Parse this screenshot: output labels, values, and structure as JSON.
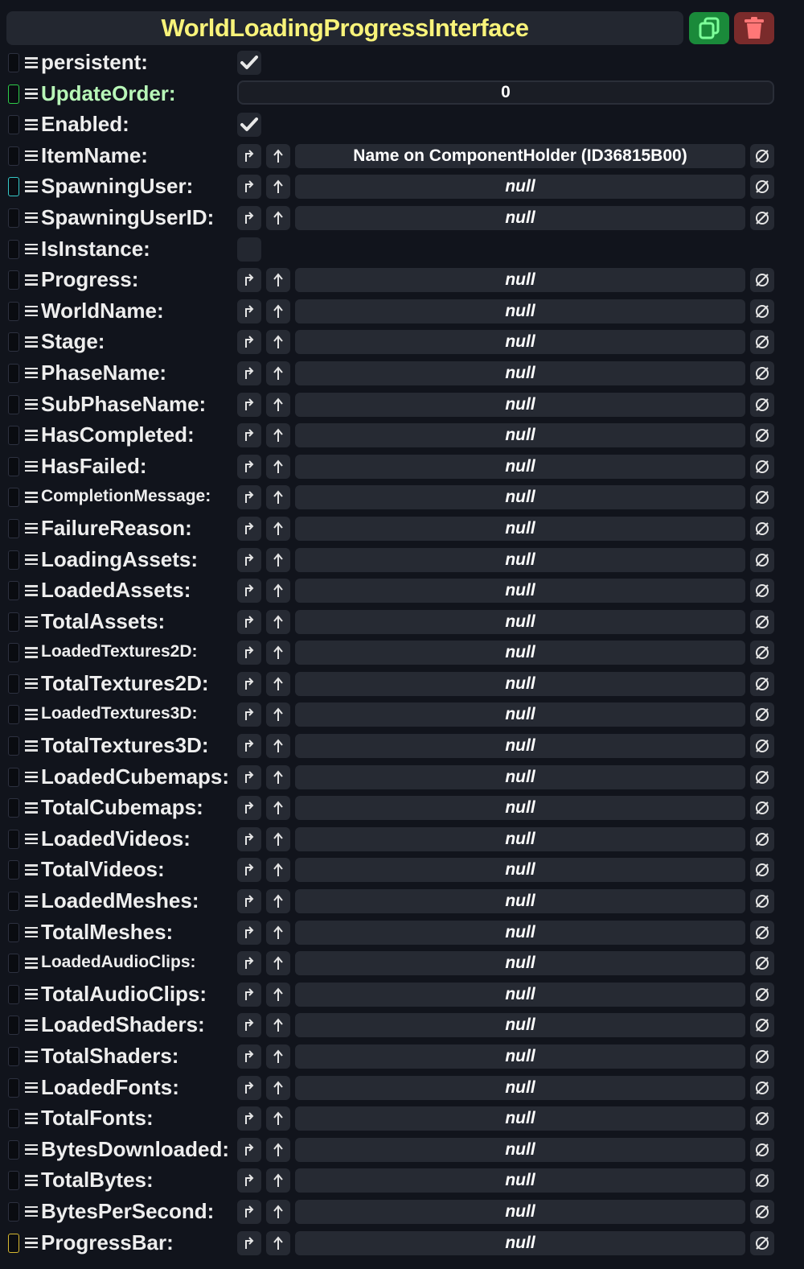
{
  "header": {
    "title": "WorldLoadingProgressInterface",
    "icons": {
      "duplicate": "duplicate-icon",
      "delete": "trash-icon"
    }
  },
  "colors": {
    "title": "#f8f37a",
    "duplicate_button": "#1a8a3a",
    "delete_button": "#7a2b2b",
    "indicator_green": "#2ecc4a",
    "indicator_cyan": "#35c9c9",
    "indicator_yellow": "#d6b830"
  },
  "rows": [
    {
      "label": "persistent:",
      "type": "checkbox",
      "checked": true
    },
    {
      "label": "UpdateOrder:",
      "type": "number",
      "value": "0",
      "indicator": "green",
      "label_color": "green"
    },
    {
      "label": "Enabled:",
      "type": "checkbox",
      "checked": true
    },
    {
      "label": "ItemName:",
      "type": "ref",
      "value": "Name on ComponentHolder (ID36815B00)"
    },
    {
      "label": "SpawningUser:",
      "type": "ref",
      "value": "null",
      "indicator": "cyan"
    },
    {
      "label": "SpawningUserID:",
      "type": "ref",
      "value": "null"
    },
    {
      "label": "IsInstance:",
      "type": "checkbox",
      "checked": false
    },
    {
      "label": "Progress:",
      "type": "ref",
      "value": "null"
    },
    {
      "label": "WorldName:",
      "type": "ref",
      "value": "null"
    },
    {
      "label": "Stage:",
      "type": "ref",
      "value": "null"
    },
    {
      "label": "PhaseName:",
      "type": "ref",
      "value": "null"
    },
    {
      "label": "SubPhaseName:",
      "type": "ref",
      "value": "null"
    },
    {
      "label": "HasCompleted:",
      "type": "ref",
      "value": "null"
    },
    {
      "label": "HasFailed:",
      "type": "ref",
      "value": "null"
    },
    {
      "label": "CompletionMessage:",
      "type": "ref",
      "value": "null",
      "small": true
    },
    {
      "label": "FailureReason:",
      "type": "ref",
      "value": "null"
    },
    {
      "label": "LoadingAssets:",
      "type": "ref",
      "value": "null"
    },
    {
      "label": "LoadedAssets:",
      "type": "ref",
      "value": "null"
    },
    {
      "label": "TotalAssets:",
      "type": "ref",
      "value": "null"
    },
    {
      "label": "LoadedTextures2D:",
      "type": "ref",
      "value": "null",
      "small": true
    },
    {
      "label": "TotalTextures2D:",
      "type": "ref",
      "value": "null"
    },
    {
      "label": "LoadedTextures3D:",
      "type": "ref",
      "value": "null",
      "small": true
    },
    {
      "label": "TotalTextures3D:",
      "type": "ref",
      "value": "null"
    },
    {
      "label": "LoadedCubemaps:",
      "type": "ref",
      "value": "null"
    },
    {
      "label": "TotalCubemaps:",
      "type": "ref",
      "value": "null"
    },
    {
      "label": "LoadedVideos:",
      "type": "ref",
      "value": "null"
    },
    {
      "label": "TotalVideos:",
      "type": "ref",
      "value": "null"
    },
    {
      "label": "LoadedMeshes:",
      "type": "ref",
      "value": "null"
    },
    {
      "label": "TotalMeshes:",
      "type": "ref",
      "value": "null"
    },
    {
      "label": "LoadedAudioClips:",
      "type": "ref",
      "value": "null",
      "small": true
    },
    {
      "label": "TotalAudioClips:",
      "type": "ref",
      "value": "null"
    },
    {
      "label": "LoadedShaders:",
      "type": "ref",
      "value": "null"
    },
    {
      "label": "TotalShaders:",
      "type": "ref",
      "value": "null"
    },
    {
      "label": "LoadedFonts:",
      "type": "ref",
      "value": "null"
    },
    {
      "label": "TotalFonts:",
      "type": "ref",
      "value": "null"
    },
    {
      "label": "BytesDownloaded:",
      "type": "ref",
      "value": "null"
    },
    {
      "label": "TotalBytes:",
      "type": "ref",
      "value": "null"
    },
    {
      "label": "BytesPerSecond:",
      "type": "ref",
      "value": "null"
    },
    {
      "label": "ProgressBar:",
      "type": "ref",
      "value": "null",
      "indicator": "yellow"
    }
  ]
}
